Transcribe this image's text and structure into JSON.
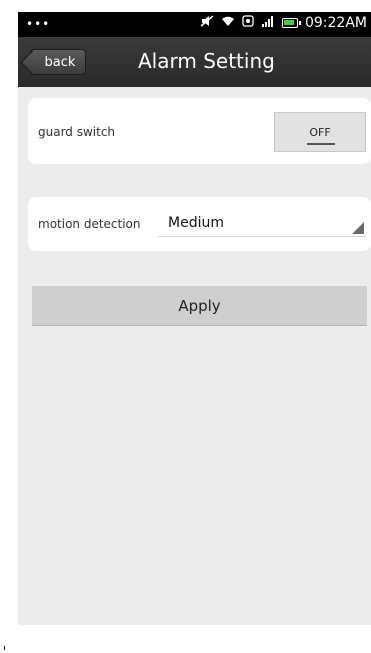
{
  "status_bar": {
    "dots": "•••",
    "time": "09:22AM",
    "icons": [
      "mute-icon",
      "wifi-icon",
      "sync-icon",
      "signal-icon",
      "battery-icon"
    ]
  },
  "header": {
    "back_label": "back",
    "title": "Alarm Setting"
  },
  "guard": {
    "label": "guard switch",
    "toggle_value": "OFF"
  },
  "motion": {
    "label": "motion detection",
    "selected": "Medium"
  },
  "apply": {
    "label": "Apply"
  },
  "colors": {
    "background": "#ececec",
    "header": "#2f2f2f",
    "status_bar": "#000000",
    "battery": "#3dd13d"
  }
}
